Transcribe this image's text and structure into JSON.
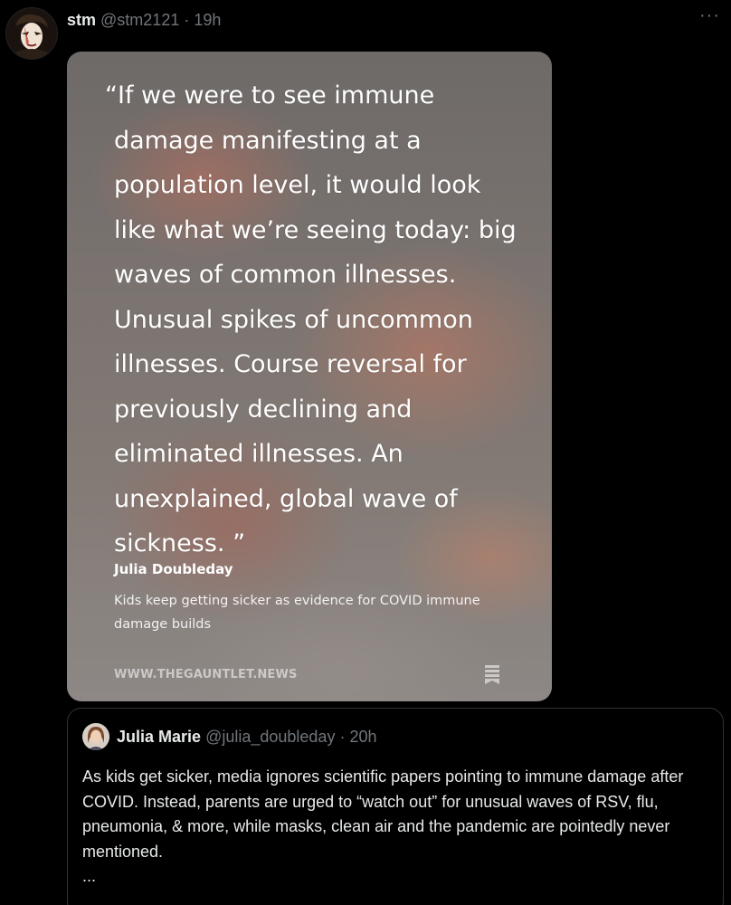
{
  "post": {
    "display_name": "stm",
    "handle": "@stm2121",
    "separator": "·",
    "time": "19h",
    "more_label": "···"
  },
  "media": {
    "quote": "“If we were to see immune damage manifesting at a population level, it would look like what we’re seeing today: big waves of common illnesses. Unusual spikes of uncommon illnesses. Course reversal for previously declining and eliminated illnesses. An unexplained, global wave of sickness. ”",
    "author": "Julia Doubleday",
    "source_title": "Kids keep getting sicker as evidence for COVID immune damage builds",
    "site": "WWW.THEGAUNTLET.NEWS",
    "icon": "bookmark-icon"
  },
  "quoted_tweet": {
    "display_name": "Julia Marie",
    "handle": "@julia_doubleday",
    "separator": "·",
    "time": "20h",
    "body": "As kids get sicker, media ignores scientific papers pointing to immune damage after COVID. Instead, parents are urged to “watch out” for unusual waves of RSV, flu, pneumonia, & more, while masks, clean air and the pandemic are pointedly never mentioned.",
    "truncation": "..."
  },
  "colors": {
    "background": "#000000",
    "primary_text": "#e7e9ea",
    "secondary_text": "#71767b",
    "border": "#2f3336"
  }
}
